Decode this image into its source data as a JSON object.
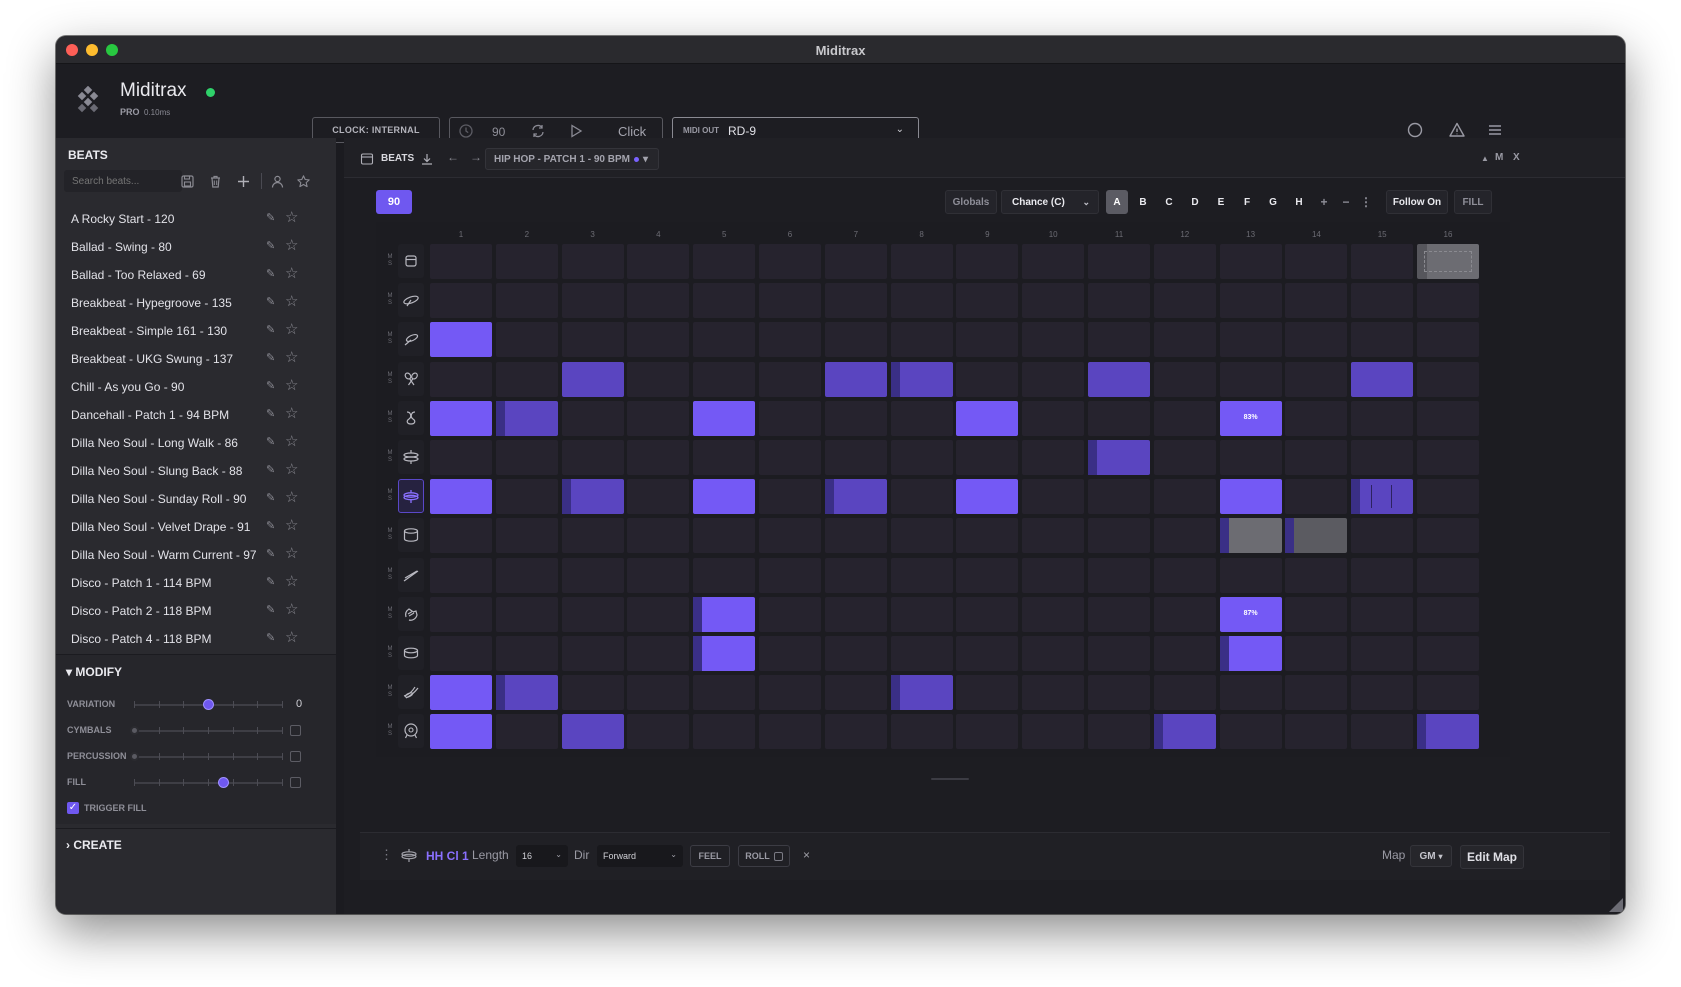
{
  "window": {
    "title": "Miditrax"
  },
  "header": {
    "app_name": "Miditrax",
    "edition": "PRO",
    "latency": "0.10ms",
    "clock_button": "CLOCK: INTERNAL",
    "tempo": "90",
    "click_label": "Click",
    "midi_out_label": "MIDI OUT",
    "midi_out_value": "RD-9"
  },
  "sidebar": {
    "title": "BEATS",
    "search_placeholder": "Search beats...",
    "beats": [
      "A Rocky Start - 120",
      "Ballad - Swing - 80",
      "Ballad - Too Relaxed - 69",
      "Breakbeat - Hypegroove - 135",
      "Breakbeat - Simple 161 - 130",
      "Breakbeat - UKG Swung - 137",
      "Chill - As you Go - 90",
      "Dancehall - Patch 1 - 94 BPM",
      "Dilla Neo Soul - Long Walk - 86",
      "Dilla Neo Soul - Slung Back - 88",
      "Dilla Neo Soul - Sunday Roll - 90",
      "Dilla Neo Soul - Velvet Drape - 91",
      "Dilla Neo Soul - Warm Current - 97",
      "Disco - Patch 1 - 114 BPM",
      "Disco - Patch 2 - 118 BPM",
      "Disco - Patch 4 - 118 BPM"
    ],
    "modify": {
      "title": "MODIFY",
      "variation_label": "VARIATION",
      "variation_value": "0",
      "variation_level": 0.5,
      "cymbals_label": "CYMBALS",
      "cymbals_level": 0,
      "percussion_label": "PERCUSSION",
      "percussion_level": 0,
      "fill_label": "FILL",
      "fill_level": 0.6,
      "trigger_fill_label": "TRIGGER FILL",
      "trigger_fill_checked": true
    },
    "create_title": "CREATE"
  },
  "panel": {
    "title": "BEATS",
    "patch_name": "HIP HOP - PATCH 1 - 90 BPM",
    "ctrl_up": "▲",
    "ctrl_m": "M",
    "ctrl_x": "X"
  },
  "sequencer": {
    "bpm": "90",
    "globals": "Globals",
    "mode": "Chance (C)",
    "patterns": [
      "A",
      "B",
      "C",
      "D",
      "E",
      "F",
      "G",
      "H"
    ],
    "active_pattern": "A",
    "plus": "+",
    "minus": "−",
    "more": "⋮",
    "follow": "Follow On",
    "fill": "FILL",
    "columns": [
      "1",
      "2",
      "3",
      "4",
      "5",
      "6",
      "7",
      "8",
      "9",
      "10",
      "11",
      "12",
      "13",
      "14",
      "15",
      "16"
    ],
    "ms_label": "M S",
    "rows": [
      {
        "icon": "box-icon",
        "cells": {
          "16": "ghost-dotted"
        }
      },
      {
        "icon": "cymbal-ride-icon",
        "cells": {}
      },
      {
        "icon": "cymbal-crash-icon",
        "cells": {
          "1": "on"
        }
      },
      {
        "icon": "maracas-icon",
        "cells": {
          "3": "dim",
          "7": "dim",
          "8": "dim-flam",
          "11": "dim",
          "15": "dim"
        }
      },
      {
        "icon": "shaker-icon",
        "cells": {
          "1": "on",
          "2": "dim-flam",
          "5": "on",
          "9": "on",
          "13": "on"
        },
        "labels": {
          "13": "83%"
        }
      },
      {
        "icon": "hihat-open-icon",
        "cells": {
          "11": "dim-flam"
        }
      },
      {
        "icon": "hihat-closed-icon",
        "selected": true,
        "cells": {
          "1": "on",
          "3": "dim-flam",
          "5": "on",
          "7": "dim-flam",
          "9": "on",
          "13": "on",
          "15": "dim-roll"
        }
      },
      {
        "icon": "snare-drum-icon",
        "cells": {
          "13": "ghost-flam",
          "14": "ghost2-flam"
        }
      },
      {
        "icon": "drumstick-icon",
        "cells": {}
      },
      {
        "icon": "clap-icon",
        "cells": {
          "5": "on-flam",
          "13": "on"
        },
        "labels": {
          "13": "87%"
        }
      },
      {
        "icon": "tom-icon",
        "cells": {
          "5": "on-flam",
          "13": "on-flam"
        }
      },
      {
        "icon": "rimshot-icon",
        "cells": {
          "1": "on",
          "2": "dim-flam",
          "8": "dim-flam"
        }
      },
      {
        "icon": "kick-drum-icon",
        "cells": {
          "1": "on",
          "3": "dim",
          "12": "dim-flam",
          "16": "dim-flam"
        }
      }
    ]
  },
  "footer": {
    "instrument": "HH Cl 1",
    "length_label": "Length",
    "length_value": "16",
    "dir_label": "Dir",
    "dir_value": "Forward",
    "feel": "FEEL",
    "roll": "ROLL",
    "close": "×",
    "map_label": "Map",
    "map_value": "GM",
    "edit_map": "Edit Map"
  }
}
